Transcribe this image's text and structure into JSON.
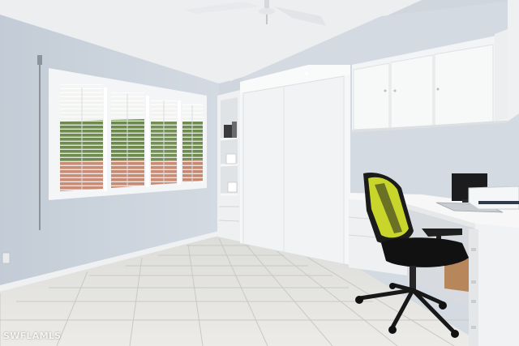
{
  "watermark": {
    "text": "SWFLAMLS"
  },
  "colors": {
    "wall": "#cdd5dd",
    "ceiling": "#ebedef",
    "cabinet": "#f3f4f5",
    "floor_tile": "#e6e6e3",
    "chair_accent": "#c8d62b",
    "chair_frame": "#1a1a1a"
  },
  "icons": [
    "ceiling-fan-icon",
    "office-chair-icon",
    "monitor-icon",
    "printer-icon",
    "laptop-icon",
    "electrical-outlet-icon"
  ]
}
